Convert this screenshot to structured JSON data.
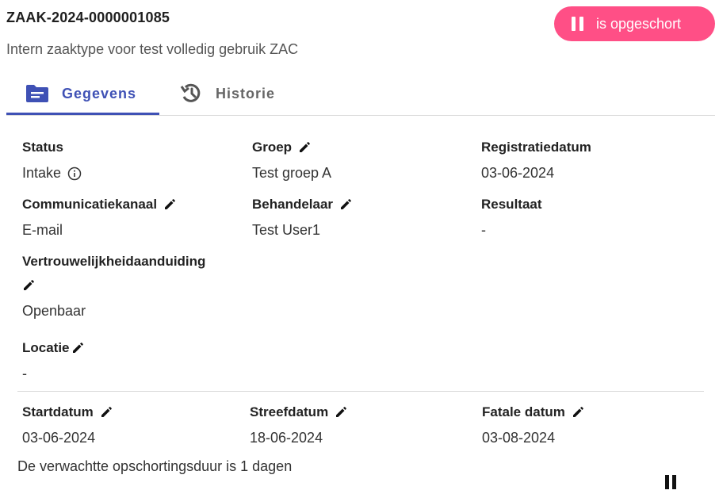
{
  "header": {
    "case_id": "ZAAK-2024-0000001085",
    "subtitle": "Intern zaaktype voor test volledig gebruik ZAC",
    "status_chip": {
      "label": "is opgeschort",
      "color": "#ff4f86",
      "icon": "pause-icon"
    }
  },
  "tabs": [
    {
      "label": "Gegevens",
      "icon": "folder-icon",
      "active": true
    },
    {
      "label": "Historie",
      "icon": "history-icon",
      "active": false
    }
  ],
  "fields": {
    "status": {
      "label": "Status",
      "value": "Intake"
    },
    "groep": {
      "label": "Groep",
      "value": "Test groep A"
    },
    "registratiedatum": {
      "label": "Registratiedatum",
      "value": "03-06-2024"
    },
    "communicatiekanaal": {
      "label": "Communicatiekanaal",
      "value": "E-mail"
    },
    "behandelaar": {
      "label": "Behandelaar",
      "value": "Test User1"
    },
    "resultaat": {
      "label": "Resultaat",
      "value": "-"
    },
    "vertrouwelijkheid": {
      "label": "Vertrouwelijkheidaanduiding",
      "value": "Openbaar"
    },
    "locatie": {
      "label": "Locatie",
      "value": "-"
    },
    "startdatum": {
      "label": "Startdatum",
      "value": "03-06-2024"
    },
    "streefdatum": {
      "label": "Streefdatum",
      "value": "18-06-2024"
    },
    "fatale_datum": {
      "label": "Fatale datum",
      "value": "03-08-2024"
    }
  },
  "suspension_note": "De verwachtte opschortingsduur is 1 dagen",
  "colors": {
    "accent": "#3f51b5",
    "chip": "#ff4f86"
  }
}
